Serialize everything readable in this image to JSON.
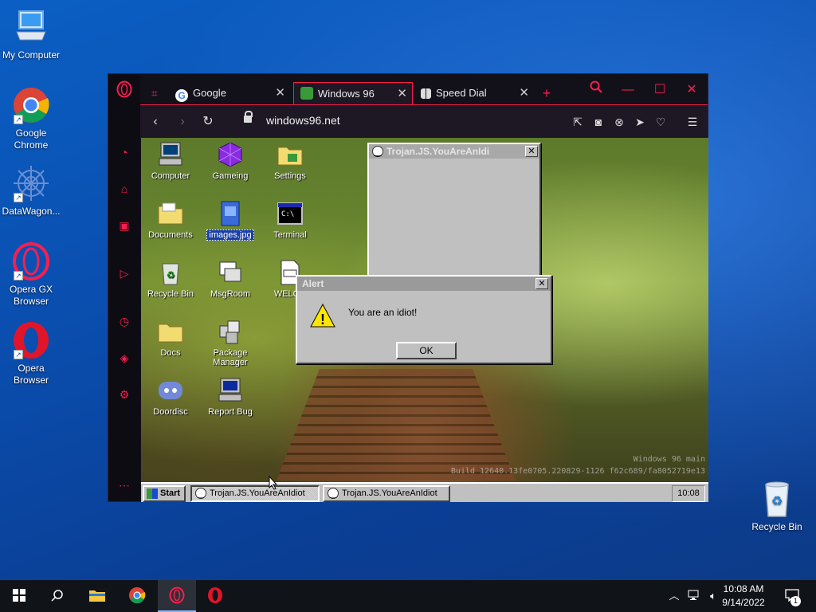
{
  "host_desktop": {
    "icons": [
      {
        "label": "My Computer",
        "icon": "computer-icon"
      },
      {
        "label": "Google Chrome",
        "icon": "chrome-icon"
      },
      {
        "label": "DataWagon...",
        "icon": "datawagon-icon"
      },
      {
        "label": "Opera GX Browser",
        "icon": "opera-gx-icon"
      },
      {
        "label": "Opera Browser",
        "icon": "opera-icon"
      },
      {
        "label": "Recycle Bin",
        "icon": "recycle-bin-icon"
      }
    ]
  },
  "browser": {
    "tabs": [
      {
        "label": "Google",
        "icon": "google-icon"
      },
      {
        "label": "Windows 96",
        "icon": "windows96-icon",
        "active": true
      },
      {
        "label": "Speed Dial",
        "icon": "speed-dial-icon"
      }
    ],
    "url": "windows96.net"
  },
  "w96": {
    "icons": [
      {
        "label": "Computer"
      },
      {
        "label": "Gameing"
      },
      {
        "label": "Settings"
      },
      {
        "label": "Documents"
      },
      {
        "label": "images.jpg",
        "selected": true
      },
      {
        "label": "Terminal"
      },
      {
        "label": "Recycle Bin"
      },
      {
        "label": "MsgRoom"
      },
      {
        "label": "WELCO"
      },
      {
        "label": "Docs"
      },
      {
        "label": "Package Manager"
      },
      {
        "label": "Doordisc"
      },
      {
        "label": "Report Bug"
      }
    ],
    "trojan_window": {
      "title": "Trojan.JS.YouAreAnIdi"
    },
    "alert": {
      "title": "Alert",
      "message": "You are an idiot!",
      "ok_label": "OK"
    },
    "build_line1": "Windows 96 main",
    "build_line2": "Build 12640.13fe0705.220829-1126 f62c689/fa8052719e13",
    "taskbar": {
      "start_label": "Start",
      "tasks": [
        "Trojan.JS.YouAreAnIdiot",
        "Trojan.JS.YouAreAnIdiot"
      ],
      "clock": "10:08"
    }
  },
  "win_taskbar": {
    "time": "10:08 AM",
    "date": "9/14/2022",
    "notification_count": "1"
  },
  "colors": {
    "opera_gx_accent": "#fa1e4e",
    "win10_bg": "#0a4fb0"
  }
}
